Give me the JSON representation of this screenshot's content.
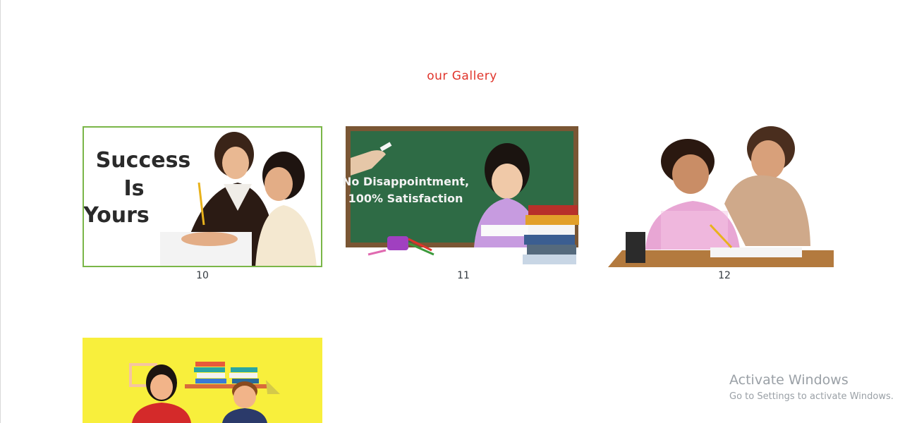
{
  "gallery": {
    "heading": "our Gallery",
    "items": [
      {
        "caption": "10",
        "image": {
          "lines": [
            "Success",
            "Is",
            "Yours"
          ]
        }
      },
      {
        "caption": "11",
        "image": {
          "lines": [
            "No Disappointment,",
            "100% Satisfaction"
          ]
        }
      },
      {
        "caption": "12"
      },
      {
        "caption": ""
      }
    ]
  },
  "watermark": {
    "title": "Activate Windows",
    "subtitle": "Go to Settings to activate Windows."
  },
  "colors": {
    "heading": "#e0342b",
    "thumb_border": "#7ab648",
    "chalkboard": "#2e6b45",
    "yellow": "#f8ef3c"
  }
}
